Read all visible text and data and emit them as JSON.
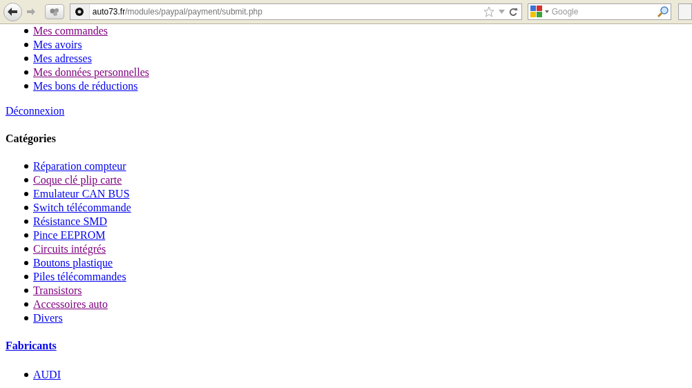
{
  "toolbar": {
    "url_host": "auto73.fr",
    "url_path": "/modules/paypal/payment/submit.php",
    "search_placeholder": "Google"
  },
  "account_links": [
    {
      "label": "Mes commandes",
      "visited": true
    },
    {
      "label": "Mes avoirs",
      "visited": false
    },
    {
      "label": "Mes adresses",
      "visited": false
    },
    {
      "label": "Mes données personnelles",
      "visited": true
    },
    {
      "label": "Mes bons de réductions",
      "visited": false
    }
  ],
  "logout": {
    "label": "Déconnexion",
    "visited": false
  },
  "categories": {
    "title": "Catégories",
    "items": [
      {
        "label": "Réparation compteur",
        "visited": false
      },
      {
        "label": "Coque clé plip carte",
        "visited": true
      },
      {
        "label": "Emulateur CAN BUS",
        "visited": false
      },
      {
        "label": "Switch télécommande",
        "visited": false
      },
      {
        "label": "Résistance SMD",
        "visited": false
      },
      {
        "label": "Pince EEPROM",
        "visited": false
      },
      {
        "label": "Circuits intégrés",
        "visited": true
      },
      {
        "label": "Boutons plastique",
        "visited": false
      },
      {
        "label": "Piles télécommandes",
        "visited": false
      },
      {
        "label": "Transistors",
        "visited": true
      },
      {
        "label": "Accessoires auto",
        "visited": true
      },
      {
        "label": "Divers",
        "visited": false
      }
    ]
  },
  "manufacturers": {
    "title": {
      "label": "Fabricants",
      "visited": false
    },
    "items": [
      {
        "label": "AUDI",
        "visited": false
      }
    ]
  }
}
